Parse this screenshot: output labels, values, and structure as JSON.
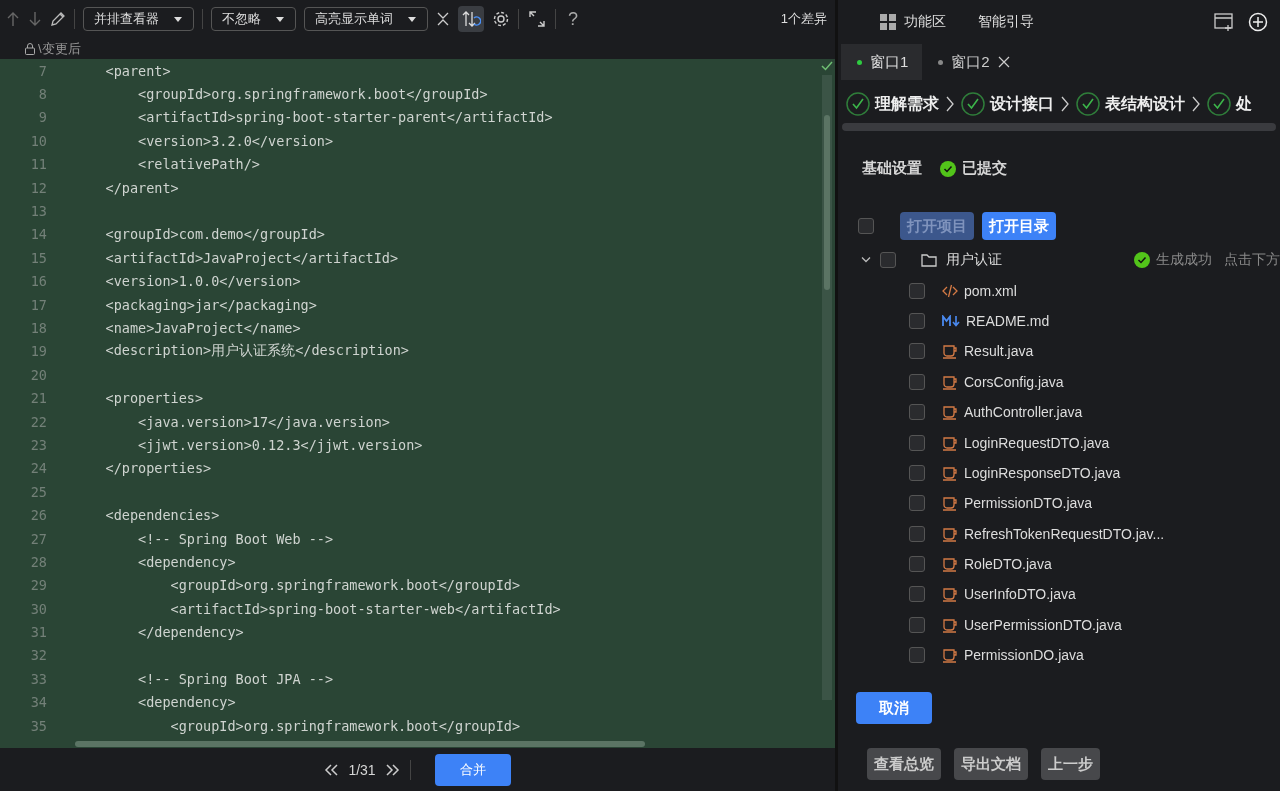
{
  "toolbar": {
    "view_mode": "并排查看器",
    "ignore_mode": "不忽略",
    "highlight_mode": "高亮显示单词",
    "sync_scroll": {
      "on": true
    },
    "help": "?",
    "diff_count": "1个差异"
  },
  "editor": {
    "path": "\\变更后",
    "lines": [
      {
        "number": "7",
        "text": "    <parent>"
      },
      {
        "number": "8",
        "text": "        <groupId>org.springframework.boot</groupId>"
      },
      {
        "number": "9",
        "text": "        <artifactId>spring-boot-starter-parent</artifactId>"
      },
      {
        "number": "10",
        "text": "        <version>3.2.0</version>"
      },
      {
        "number": "11",
        "text": "        <relativePath/>"
      },
      {
        "number": "12",
        "text": "    </parent>"
      },
      {
        "number": "13"
      },
      {
        "number": "14",
        "text": "    <groupId>com.demo</groupId>"
      },
      {
        "number": "15",
        "text": "    <artifactId>JavaProject</artifactId>"
      },
      {
        "number": "16",
        "text": "    <version>1.0.0</version>"
      },
      {
        "number": "17",
        "text": "    <packaging>jar</packaging>"
      },
      {
        "number": "18",
        "text": "    <name>JavaProject</name>"
      },
      {
        "number": "19",
        "text": "    <description>用户认证系统</description>"
      },
      {
        "number": "20"
      },
      {
        "number": "21",
        "text": "    <properties>"
      },
      {
        "number": "22",
        "text": "        <java.version>17</java.version>"
      },
      {
        "number": "23",
        "text": "        <jjwt.version>0.12.3</jjwt.version>"
      },
      {
        "number": "24",
        "text": "    </properties>"
      },
      {
        "number": "25"
      },
      {
        "number": "26",
        "text": "    <dependencies>"
      },
      {
        "number": "27",
        "text": "        <!-- Spring Boot Web -->"
      },
      {
        "number": "28",
        "text": "        <dependency>"
      },
      {
        "number": "29",
        "text": "            <groupId>org.springframework.boot</groupId>"
      },
      {
        "number": "30",
        "text": "            <artifactId>spring-boot-starter-web</artifactId>"
      },
      {
        "number": "31",
        "text": "        </dependency>"
      },
      {
        "number": "32"
      },
      {
        "number": "33",
        "text": "        <!-- Spring Boot JPA -->"
      },
      {
        "number": "34",
        "text": "        <dependency>"
      },
      {
        "number": "35",
        "text": "            <groupId>org.springframework.boot</groupId>"
      }
    ],
    "pager": "1/31",
    "merge": "合并"
  },
  "panel": {
    "header_tabs": [
      {
        "label": "功能区",
        "selected": false
      },
      {
        "label": "智能引导",
        "selected": false
      }
    ],
    "windows": [
      {
        "label": "窗口1",
        "selected": true,
        "closable": false
      },
      {
        "label": "窗口2",
        "selected": false,
        "closable": true
      }
    ],
    "steps": [
      {
        "label": "理解需求",
        "done": true
      },
      {
        "label": "设计接口",
        "done": true
      },
      {
        "label": "表结构设计",
        "done": true
      },
      {
        "label": "处",
        "done": true
      }
    ],
    "section": {
      "title": "基础设置",
      "status": "已提交"
    },
    "select_all": {
      "checked": false
    },
    "actions": [
      {
        "label": "打开项目",
        "disabled": true
      },
      {
        "label": "打开目录",
        "disabled": false
      }
    ],
    "tree": [
      {
        "name": "用户认证",
        "kind": "folder",
        "expanded": true,
        "checked": false,
        "status": "生成成功",
        "hint": "点击下方",
        "children": [
          {
            "name": "pom.xml",
            "kind": "xml",
            "checked": false
          },
          {
            "name": "README.md",
            "kind": "markdown",
            "checked": false
          },
          {
            "name": "Result.java",
            "kind": "java",
            "checked": false
          },
          {
            "name": "CorsConfig.java",
            "kind": "java",
            "checked": false
          },
          {
            "name": "AuthController.java",
            "kind": "java",
            "checked": false
          },
          {
            "name": "LoginRequestDTO.java",
            "kind": "java",
            "checked": false
          },
          {
            "name": "LoginResponseDTO.java",
            "kind": "java",
            "checked": false
          },
          {
            "name": "PermissionDTO.java",
            "kind": "java",
            "checked": false
          },
          {
            "name": "RefreshTokenRequestDTO.jav...",
            "kind": "java",
            "checked": false
          },
          {
            "name": "RoleDTO.java",
            "kind": "java",
            "checked": false
          },
          {
            "name": "UserInfoDTO.java",
            "kind": "java",
            "checked": false
          },
          {
            "name": "UserPermissionDTO.java",
            "kind": "java",
            "checked": false
          },
          {
            "name": "PermissionDO.java",
            "kind": "java",
            "checked": false
          }
        ]
      }
    ],
    "cancel": "取消",
    "footer_buttons": [
      "查看总览",
      "导出文档",
      "上一步"
    ]
  }
}
